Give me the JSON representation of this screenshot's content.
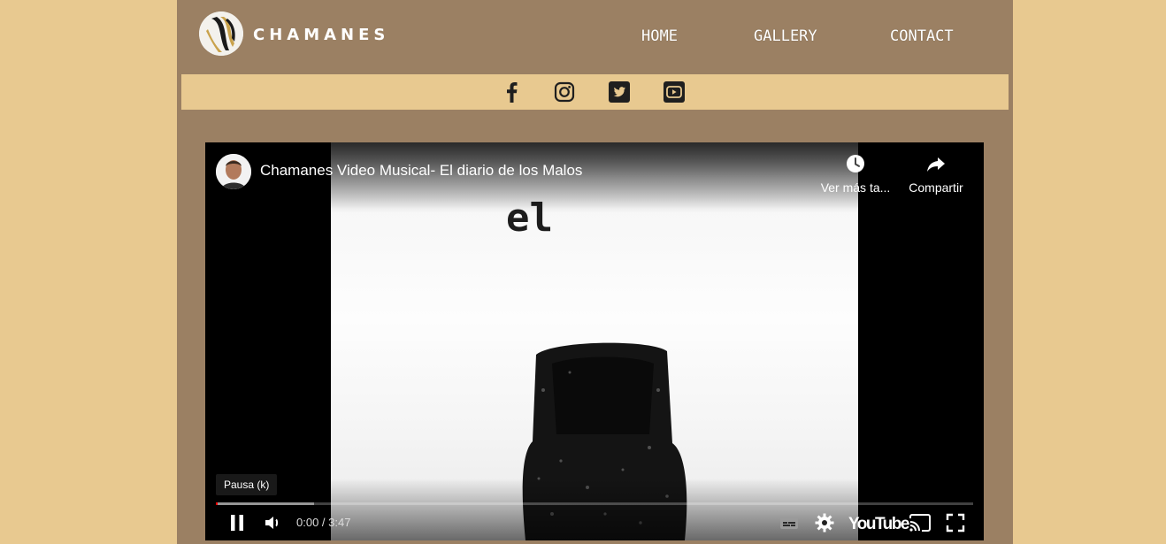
{
  "header": {
    "logo_text": "CHAMANES",
    "nav": [
      {
        "label": "HOME"
      },
      {
        "label": "GALLERY"
      },
      {
        "label": "CONTACT"
      }
    ]
  },
  "social": [
    {
      "icon": "facebook-icon"
    },
    {
      "icon": "instagram-icon"
    },
    {
      "icon": "twitter-icon"
    },
    {
      "icon": "youtube-icon"
    }
  ],
  "video": {
    "title": "Chamanes Video Musical- El diario de los Malos",
    "frame_text": "el",
    "watch_later_label": "Ver más ta...",
    "share_label": "Compartir",
    "tooltip": "Pausa (k)",
    "time_current": "0:00",
    "time_separator": " / ",
    "time_total": "3:47",
    "youtube_label": "YouTube",
    "progress_played": 0.0,
    "progress_loaded": 0.13
  },
  "colors": {
    "background": "#e8c990",
    "page": "#9b8063",
    "progress_played": "#ff0000"
  }
}
